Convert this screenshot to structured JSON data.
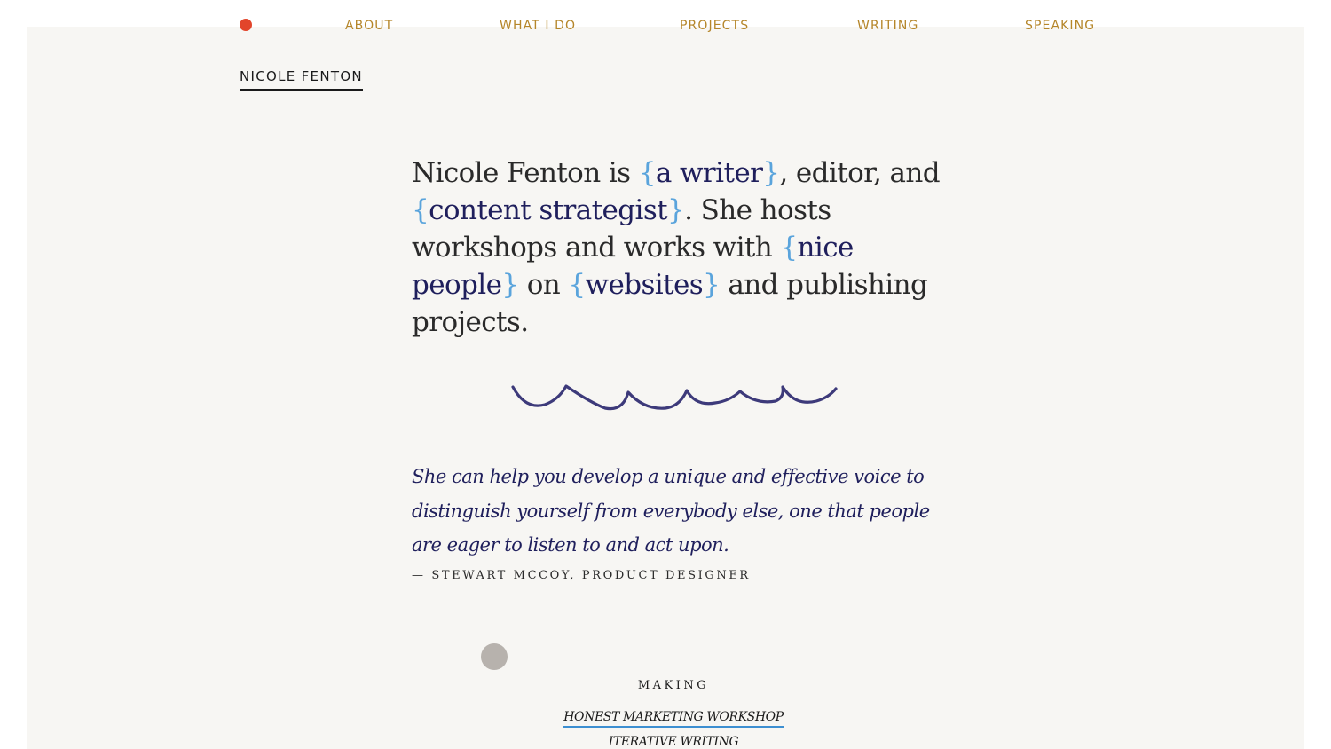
{
  "nav": {
    "items": [
      "ABOUT",
      "WHAT I DO",
      "PROJECTS",
      "WRITING",
      "SPEAKING"
    ]
  },
  "site": {
    "name": "NICOLE FENTON"
  },
  "intro": {
    "p1": "Nicole Fenton is ",
    "h1": "a writer",
    "p2": ", editor, and ",
    "h2": "content strategist",
    "p3": ". She hosts workshops and works with ",
    "h3": "nice people",
    "p4": " on ",
    "h4": "websites",
    "p5": " and publishing projects.",
    "open_brace": "{",
    "close_brace": "}"
  },
  "testimonial": {
    "quote": "She can help you develop a unique and effective voice to distinguish yourself from everybody else, one that people are eager to listen to and act upon.",
    "attribution": "— STEWART MCCOY, PRODUCT DESIGNER"
  },
  "making": {
    "heading": "MAKING",
    "links": [
      "HONEST MARKETING WORKSHOP",
      "ITERATIVE WRITING"
    ]
  },
  "colors": {
    "accent_dot": "#e2452b",
    "nav_link": "#b5862a",
    "highlight": "#1f1f5c",
    "brace": "#5aa4dc",
    "wave": "#3d3a7a",
    "background": "#f7f6f3"
  }
}
